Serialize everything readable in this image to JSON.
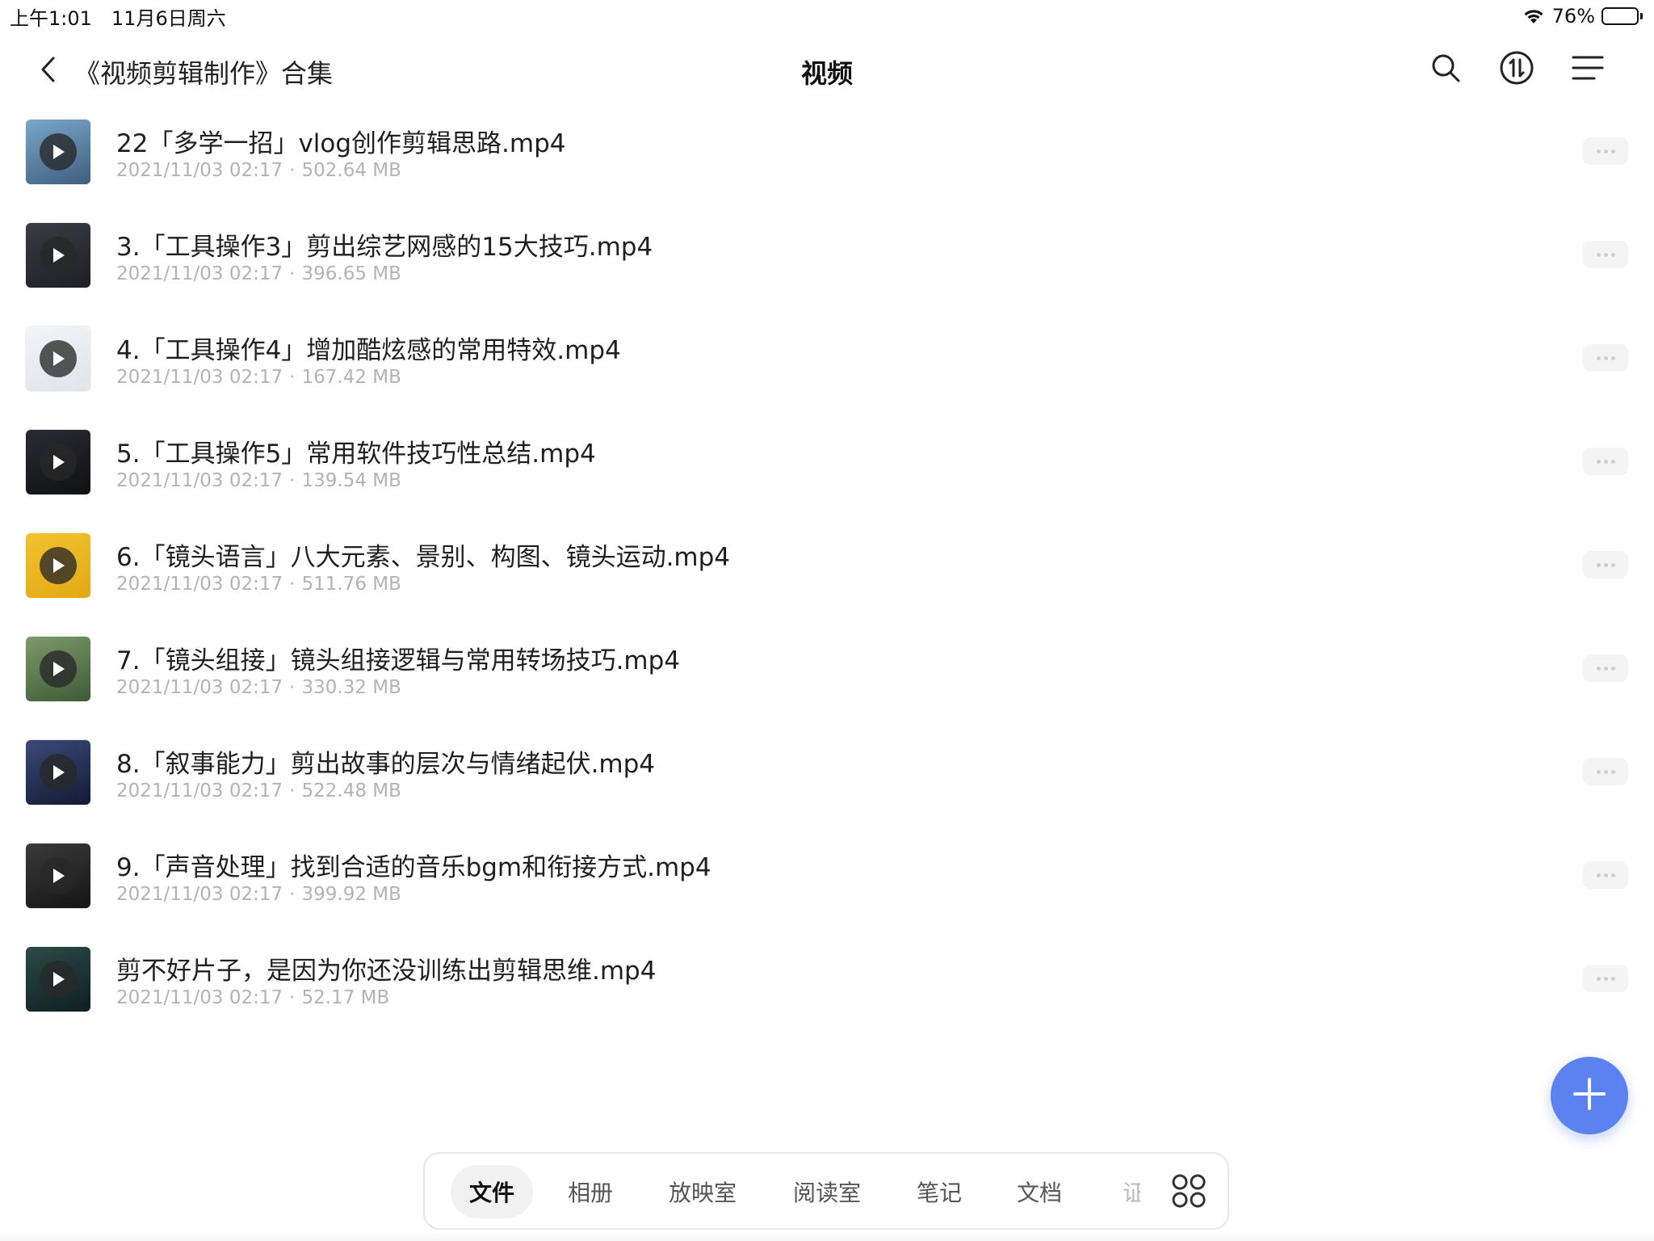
{
  "status_bar": {
    "time": "上午1:01",
    "date": "11月6日周六",
    "battery_percent": "76%",
    "battery_level": 0.76
  },
  "nav": {
    "back_icon": "chevron-left-icon",
    "collection_title": "《视频剪辑制作》合集",
    "page_title": "视频",
    "actions": [
      "search-icon",
      "sort-icon",
      "menu-icon"
    ]
  },
  "files": [
    {
      "name": "22「多学一招」vlog创作剪辑思路.mp4",
      "date": "2021/11/03 02:17",
      "size": "502.64 MB",
      "thumb_colors": [
        "#7aa7c9",
        "#3e5f7e"
      ]
    },
    {
      "name": "3.「工具操作3」剪出综艺网感的15大技巧.mp4",
      "date": "2021/11/03 02:17",
      "size": "396.65 MB",
      "thumb_colors": [
        "#3a3d44",
        "#1d1f24"
      ]
    },
    {
      "name": "4.「工具操作4」增加酷炫感的常用特效.mp4",
      "date": "2021/11/03 02:17",
      "size": "167.42 MB",
      "thumb_colors": [
        "#f2f4f7",
        "#dfe4ea"
      ]
    },
    {
      "name": "5.「工具操作5」常用软件技巧性总结.mp4",
      "date": "2021/11/03 02:17",
      "size": "139.54 MB",
      "thumb_colors": [
        "#2a2c33",
        "#101114"
      ]
    },
    {
      "name": "6.「镜头语言」八大元素、景别、构图、镜头运动.mp4",
      "date": "2021/11/03 02:17",
      "size": "511.76 MB",
      "thumb_colors": [
        "#f2c230",
        "#e0a914"
      ]
    },
    {
      "name": "7.「镜头组接」镜头组接逻辑与常用转场技巧.mp4",
      "date": "2021/11/03 02:17",
      "size": "330.32 MB",
      "thumb_colors": [
        "#7c9a6a",
        "#3f5a37"
      ]
    },
    {
      "name": "8.「叙事能力」剪出故事的层次与情绪起伏.mp4",
      "date": "2021/11/03 02:17",
      "size": "522.48 MB",
      "thumb_colors": [
        "#3a4a7a",
        "#141a33"
      ]
    },
    {
      "name": "9.「声音处理」找到合适的音乐bgm和衔接方式.mp4",
      "date": "2021/11/03 02:17",
      "size": "399.92 MB",
      "thumb_colors": [
        "#3b3b3b",
        "#151515"
      ]
    },
    {
      "name": "剪不好片子，是因为你还没训练出剪辑思维.mp4",
      "date": "2021/11/03 02:17",
      "size": "52.17 MB",
      "thumb_colors": [
        "#2c4a48",
        "#0f1f22"
      ]
    }
  ],
  "fab": {
    "icon": "plus-icon",
    "color": "#5b82f0"
  },
  "tabs": {
    "items": [
      "文件",
      "相册",
      "放映室",
      "阅读室",
      "笔记",
      "文档"
    ],
    "active_index": 0,
    "truncated_label": "证",
    "apps_icon": "apps-grid-icon"
  }
}
